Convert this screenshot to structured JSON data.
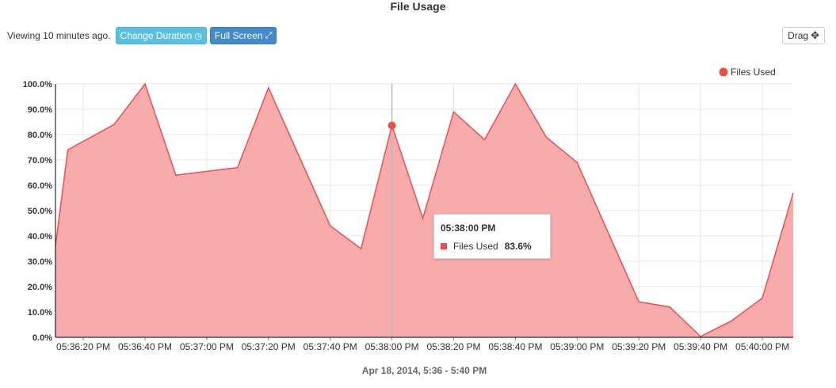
{
  "title": "File Usage",
  "toolbar": {
    "viewing_text": "Viewing 10 minutes ago.",
    "change_duration_label": "Change Duration",
    "full_screen_label": "Full Screen",
    "drag_label": "Drag"
  },
  "tooltip": {
    "time": "05:38:00 PM",
    "series": "Files Used",
    "value": "83.6%"
  },
  "date_range": "Apr 18, 2014, 5:36 - 5:40 PM",
  "colors": {
    "fill": "#f7abab",
    "line": "#e8504f",
    "grid": "#e6e6e6"
  },
  "chart_data": {
    "type": "area",
    "title": "File Usage",
    "xlabel": "Apr 18, 2014, 5:36 - 5:40 PM",
    "ylabel": "",
    "ylim": [
      0,
      100
    ],
    "y_ticks": [
      "0.0%",
      "10.0%",
      "20.0%",
      "30.0%",
      "40.0%",
      "50.0%",
      "60.0%",
      "70.0%",
      "80.0%",
      "90.0%",
      "100.0%"
    ],
    "x_tick_labels": [
      "05:36:20 PM",
      "05:36:40 PM",
      "05:37:00 PM",
      "05:37:20 PM",
      "05:37:40 PM",
      "05:38:00 PM",
      "05:38:20 PM",
      "05:38:40 PM",
      "05:39:00 PM",
      "05:39:20 PM",
      "05:39:40 PM",
      "05:40:00 PM"
    ],
    "x_range": [
      "05:36:11 PM",
      "05:40:10 PM"
    ],
    "legend_position": "top-right",
    "grid": true,
    "highlight": {
      "time": "05:38:00 PM",
      "value": 83.6
    },
    "series": [
      {
        "name": "Files Used",
        "points": [
          [
            "05:36:11 PM",
            36
          ],
          [
            "05:36:15 PM",
            74
          ],
          [
            "05:36:30 PM",
            84
          ],
          [
            "05:36:40 PM",
            100
          ],
          [
            "05:36:50 PM",
            64
          ],
          [
            "05:37:10 PM",
            67
          ],
          [
            "05:37:20 PM",
            98.5
          ],
          [
            "05:37:40 PM",
            44
          ],
          [
            "05:37:50 PM",
            35
          ],
          [
            "05:38:00 PM",
            83.6
          ],
          [
            "05:38:10 PM",
            47
          ],
          [
            "05:38:20 PM",
            89
          ],
          [
            "05:38:30 PM",
            78
          ],
          [
            "05:38:40 PM",
            100
          ],
          [
            "05:38:50 PM",
            79
          ],
          [
            "05:39:00 PM",
            69
          ],
          [
            "05:39:20 PM",
            14
          ],
          [
            "05:39:30 PM",
            12
          ],
          [
            "05:39:40 PM",
            0.3
          ],
          [
            "05:39:50 PM",
            6.5
          ],
          [
            "05:40:00 PM",
            15.5
          ],
          [
            "05:40:10 PM",
            57
          ]
        ]
      }
    ]
  }
}
